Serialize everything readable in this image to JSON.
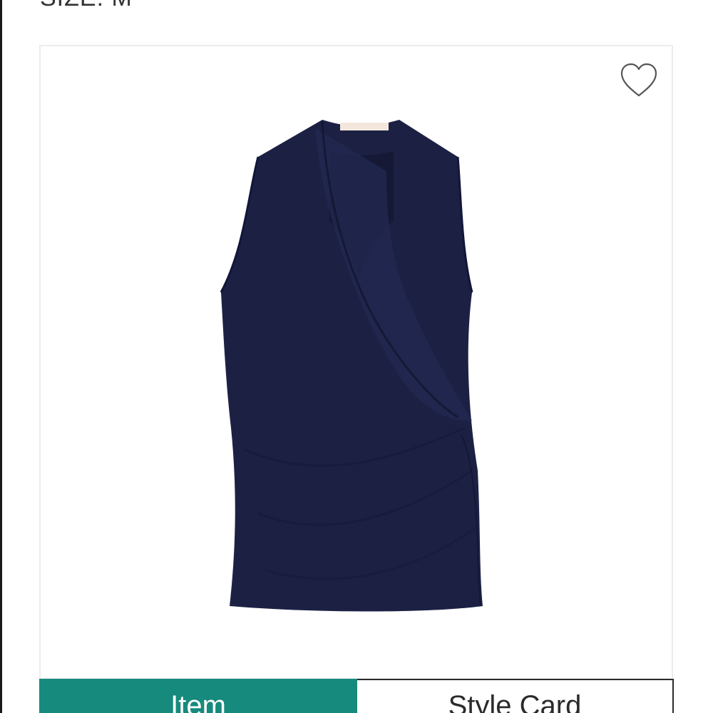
{
  "header": {
    "size_label": "SIZE: M"
  },
  "product": {
    "favorite_icon": "heart-outline-icon",
    "image_description_icon": "navy-sleeveless-wrap-top"
  },
  "tabs": [
    {
      "label": "Item",
      "active": true
    },
    {
      "label": "Style Card",
      "active": false
    }
  ],
  "colors": {
    "accent": "#168a7c",
    "garment": "#1c2144",
    "tag": "#f3e7dd"
  }
}
